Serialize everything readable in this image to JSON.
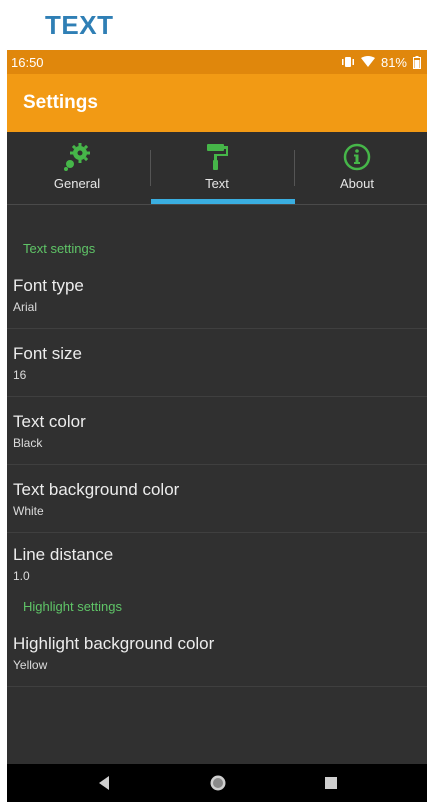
{
  "caption": "TEXT",
  "status": {
    "time": "16:50",
    "battery": "81%"
  },
  "appbar": {
    "title": "Settings"
  },
  "tabs": [
    {
      "label": "General",
      "icon": "gear-icon"
    },
    {
      "label": "Text",
      "icon": "paint-roller-icon",
      "selected": true
    },
    {
      "label": "About",
      "icon": "info-icon"
    }
  ],
  "sections": {
    "text": {
      "header": "Text settings",
      "items": [
        {
          "title": "Font type",
          "summary": "Arial"
        },
        {
          "title": "Font size",
          "summary": "16"
        },
        {
          "title": "Text color",
          "summary": "Black"
        },
        {
          "title": "Text background color",
          "summary": "White"
        },
        {
          "title": "Line distance",
          "summary": "1.0"
        }
      ]
    },
    "highlight": {
      "header": "Highlight settings",
      "items": [
        {
          "title": "Highlight background color",
          "summary": "Yellow"
        }
      ]
    }
  },
  "colors": {
    "statusbar": "#e0870c",
    "appbar": "#f29a14",
    "accent": "#3aaee0",
    "header_green": "#5fc467",
    "icon_green": "#46b649"
  }
}
